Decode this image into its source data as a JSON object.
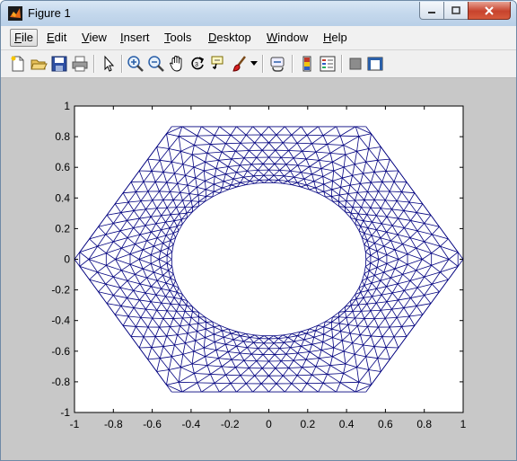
{
  "window": {
    "title": "Figure 1",
    "menu": [
      "File",
      "Edit",
      "View",
      "Insert",
      "Tools",
      "Desktop",
      "Window",
      "Help"
    ],
    "menu_mnemonics": [
      "F",
      "E",
      "V",
      "I",
      "T",
      "D",
      "W",
      "H"
    ],
    "active_menu": "File",
    "toolbar_icons": [
      "new-figure-icon",
      "open-file-icon",
      "save-icon",
      "print-icon",
      "edit-plot-arrow-icon",
      "zoom-in-icon",
      "zoom-out-icon",
      "pan-hand-icon",
      "rotate-3d-icon",
      "data-cursor-icon",
      "brush-icon",
      "brush-dropdown-icon",
      "link-plot-icon",
      "insert-colorbar-icon",
      "insert-legend-icon",
      "hide-plot-tools-icon",
      "show-plot-tools-icon"
    ]
  },
  "chart_data": {
    "type": "mesh",
    "description_of_mark": "triangular finite-element mesh of a regular hexagon (vertices at (±1,0), (±0.5,±0.866)) with a circular hole of radius 0.5 centred at the origin; element size refines toward the hole",
    "outer_hexagon": [
      [
        1,
        0
      ],
      [
        0.5,
        0.866
      ],
      [
        -0.5,
        0.866
      ],
      [
        -1,
        0
      ],
      [
        -0.5,
        -0.866
      ],
      [
        0.5,
        -0.866
      ]
    ],
    "hole": {
      "cx": 0,
      "cy": 0,
      "r": 0.5
    },
    "line_color": "#00007f",
    "xlim": [
      -1,
      1
    ],
    "ylim": [
      -1,
      1
    ],
    "xticks": [
      "-1",
      "-0.8",
      "-0.6",
      "-0.4",
      "-0.2",
      "0",
      "0.2",
      "0.4",
      "0.6",
      "0.8",
      "1"
    ],
    "yticks": [
      "1",
      "0.8",
      "0.6",
      "0.4",
      "0.2",
      "0",
      "-0.2",
      "-0.4",
      "-0.6",
      "-0.8",
      "-1"
    ],
    "title": "",
    "xlabel": "",
    "ylabel": "",
    "grid": false
  }
}
